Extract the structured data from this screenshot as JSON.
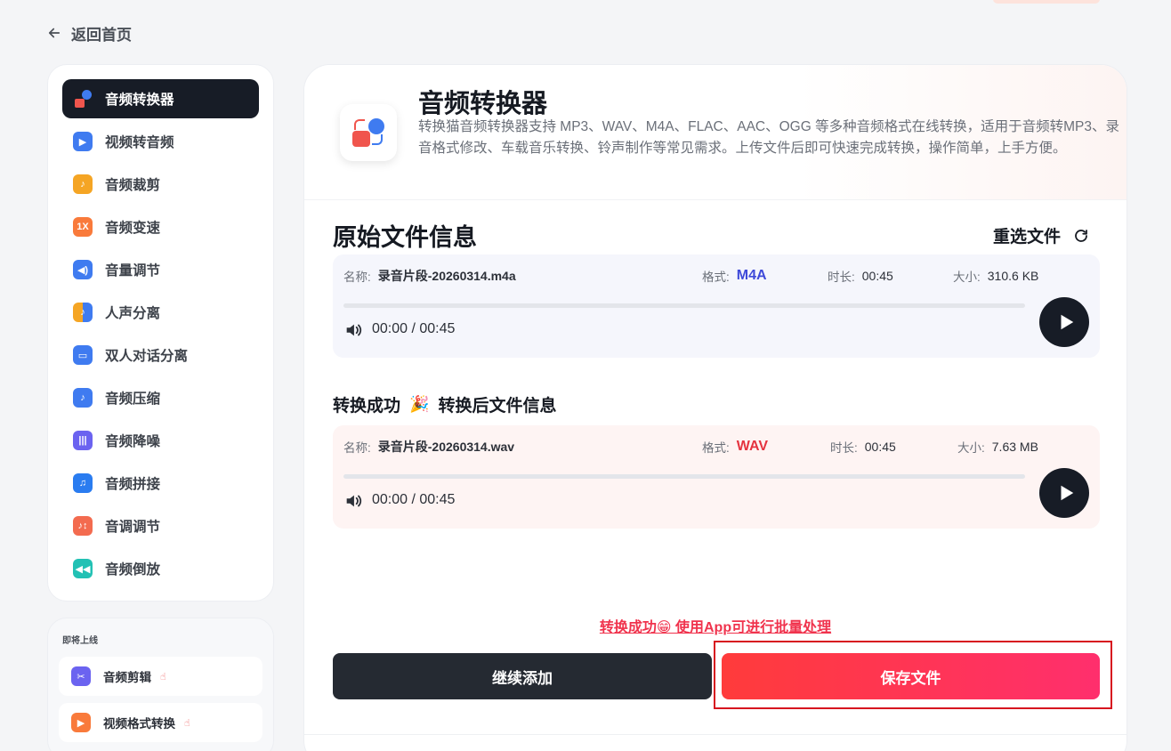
{
  "back": {
    "label": "返回首页"
  },
  "sidebar": {
    "items": [
      {
        "label": "音频转换器",
        "icon": "audio-converter-icon",
        "active": true
      },
      {
        "label": "视频转音频",
        "icon": "video-to-audio-icon",
        "color": "#3f7bf0"
      },
      {
        "label": "音频裁剪",
        "icon": "audio-trim-icon",
        "color": "#f5a524"
      },
      {
        "label": "音频变速",
        "icon": "audio-speed-icon",
        "color": "#f97a3b",
        "glyph": "1X"
      },
      {
        "label": "音量调节",
        "icon": "volume-adjust-icon",
        "color": "#3f7bf0"
      },
      {
        "label": "人声分离",
        "icon": "vocal-separation-icon",
        "color": "#f5a524"
      },
      {
        "label": "双人对话分离",
        "icon": "dialogue-separation-icon",
        "color": "#3f7bf0"
      },
      {
        "label": "音频压缩",
        "icon": "audio-compress-icon",
        "color": "#3f7bf0"
      },
      {
        "label": "音频降噪",
        "icon": "noise-reduction-icon",
        "color": "#6b63f0"
      },
      {
        "label": "音频拼接",
        "icon": "audio-merge-icon",
        "color": "#2a7cf0"
      },
      {
        "label": "音调调节",
        "icon": "pitch-adjust-icon",
        "color": "#f36b4f"
      },
      {
        "label": "音频倒放",
        "icon": "audio-reverse-icon",
        "color": "#22c1b4"
      }
    ]
  },
  "coming_soon": {
    "title": "即将上线",
    "items": [
      {
        "label": "音频剪辑",
        "icon": "audio-edit-icon",
        "color": "#6b63f0"
      },
      {
        "label": "视频格式转换",
        "icon": "video-format-icon",
        "color": "#f97a3b"
      }
    ]
  },
  "header": {
    "title": "音频转换器",
    "description": "转换猫音频转换器支持 MP3、WAV、M4A、FLAC、AAC、OGG 等多种音频格式在线转换，适用于音频转MP3、录音格式修改、车载音乐转换、铃声制作等常见需求。上传文件后即可快速完成转换，操作简单，上手方便。"
  },
  "original": {
    "section_title": "原始文件信息",
    "reselect_label": "重选文件",
    "name_label": "名称:",
    "name": "录音片段-20260314.m4a",
    "format_label": "格式:",
    "format": "M4A",
    "format_color": "#3f4ad9",
    "duration_label": "时长:",
    "duration": "00:45",
    "size_label": "大小:",
    "size": "310.6 KB",
    "timecode": "00:00 / 00:45",
    "progress": 0
  },
  "converted": {
    "heading": "转换成功",
    "party_emoji": "🎉",
    "heading2": "转换后文件信息",
    "name_label": "名称:",
    "name": "录音片段-20260314.wav",
    "format_label": "格式:",
    "format": "WAV",
    "format_color": "#e5333f",
    "duration_label": "时长:",
    "duration": "00:45",
    "size_label": "大小:",
    "size": "7.63 MB",
    "timecode": "00:00 / 00:45",
    "progress": 0
  },
  "promo": "转换成功😁 使用App可进行批量处理",
  "buttons": {
    "continue": "继续添加",
    "save": "保存文件"
  }
}
